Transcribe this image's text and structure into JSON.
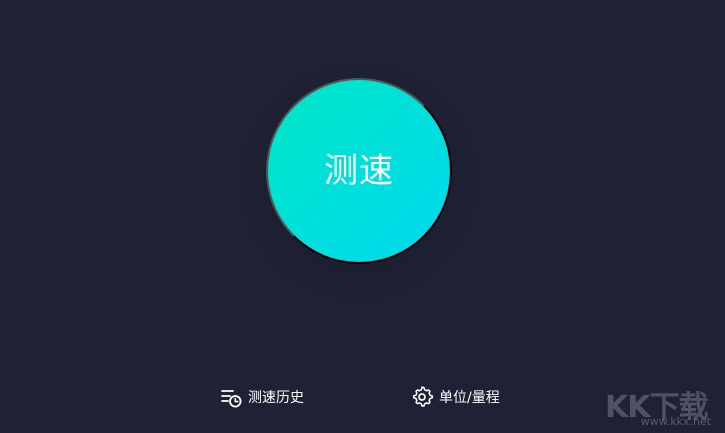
{
  "main": {
    "speed_test_label": "测速"
  },
  "bottom_bar": {
    "history_label": "测速历史",
    "unit_label": "单位/量程"
  },
  "watermark": {
    "text": "KK下载",
    "url": "www.kkx.net"
  },
  "icons": {
    "history": "history-list-clock-icon",
    "settings": "gear-icon"
  },
  "colors": {
    "background": "#1f2235",
    "button_gradient_start": "#00e7c5",
    "button_gradient_end": "#00d8f1",
    "text": "#ffffff"
  }
}
